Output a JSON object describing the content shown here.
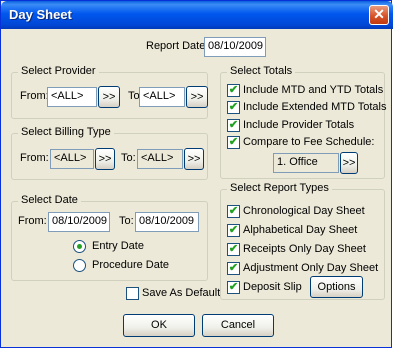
{
  "window": {
    "title": "Day Sheet",
    "close_glyph": "✕"
  },
  "report_date": {
    "label": "Report Date:",
    "value": "08/10/2009"
  },
  "select_provider": {
    "title": "Select Provider",
    "from_label": "From:",
    "from_value": "<ALL>",
    "to_label": "To:",
    "to_value": "<ALL>",
    "browse_label": ">>"
  },
  "select_billing_type": {
    "title": "Select Billing Type",
    "from_label": "From:",
    "from_value": "<ALL>",
    "to_label": "To:",
    "to_value": "<ALL>",
    "browse_label": ">>"
  },
  "select_date": {
    "title": "Select Date",
    "from_label": "From:",
    "from_value": "08/10/2009",
    "to_label": "To:",
    "to_value": "08/10/2009",
    "entry_date": {
      "label": "Entry Date",
      "selected": true
    },
    "procedure_date": {
      "label": "Procedure Date",
      "selected": false
    }
  },
  "select_totals": {
    "title": "Select Totals",
    "options": [
      {
        "label": "Include MTD and YTD Totals",
        "checked": true
      },
      {
        "label": "Include Extended MTD Totals",
        "checked": true
      },
      {
        "label": "Include Provider Totals",
        "checked": true
      },
      {
        "label": "Compare to Fee Schedule:",
        "checked": true
      }
    ],
    "fee_schedule_value": "1.  Office",
    "browse_label": ">>"
  },
  "select_report_types": {
    "title": "Select Report Types",
    "options": [
      {
        "label": "Chronological Day Sheet",
        "checked": true
      },
      {
        "label": "Alphabetical Day Sheet",
        "checked": true
      },
      {
        "label": "Receipts Only Day Sheet",
        "checked": true
      },
      {
        "label": "Adjustment Only Day Sheet",
        "checked": true
      },
      {
        "label": "Deposit Slip",
        "checked": true
      }
    ],
    "options_button": "Options"
  },
  "save_as_default": {
    "label": "Save As Default",
    "checked": false
  },
  "buttons": {
    "ok": "OK",
    "cancel": "Cancel"
  },
  "check_glyph": "✔"
}
